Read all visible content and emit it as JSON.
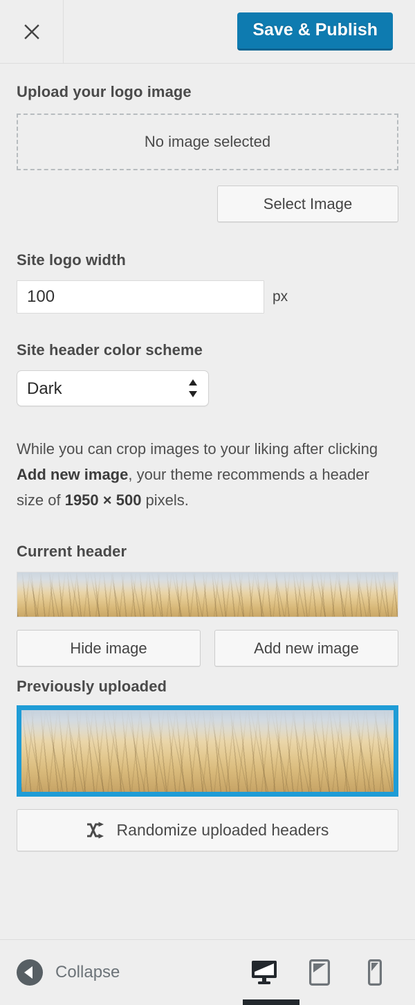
{
  "topbar": {
    "close_icon": "close-icon",
    "save_label": "Save & Publish",
    "accent_color": "#0e7bb0"
  },
  "upload_logo": {
    "title": "Upload your logo image",
    "placeholder_text": "No image selected",
    "select_button_label": "Select Image"
  },
  "logo_width": {
    "title": "Site logo width",
    "value": "100",
    "unit": "px"
  },
  "color_scheme": {
    "title": "Site header color scheme",
    "selected": "Dark",
    "options": [
      "Dark"
    ]
  },
  "description": {
    "part1": "While you can crop images to your liking after clicking ",
    "bold1": "Add new image",
    "part2": ", your theme recommends a header size of ",
    "bold2": "1950 × 500",
    "part3": " pixels."
  },
  "current_header": {
    "title": "Current header",
    "hide_button_label": "Hide image",
    "add_button_label": "Add new image"
  },
  "previously_uploaded": {
    "title": "Previously uploaded",
    "selected_border_color": "#1f9cd6",
    "randomize_label": "Randomize uploaded headers",
    "randomize_icon": "shuffle-icon"
  },
  "footer": {
    "collapse_label": "Collapse",
    "collapse_icon": "circle-arrow-left-icon",
    "devices": [
      {
        "name": "desktop-icon",
        "active": true
      },
      {
        "name": "tablet-icon",
        "active": false
      },
      {
        "name": "mobile-icon",
        "active": false
      }
    ]
  }
}
